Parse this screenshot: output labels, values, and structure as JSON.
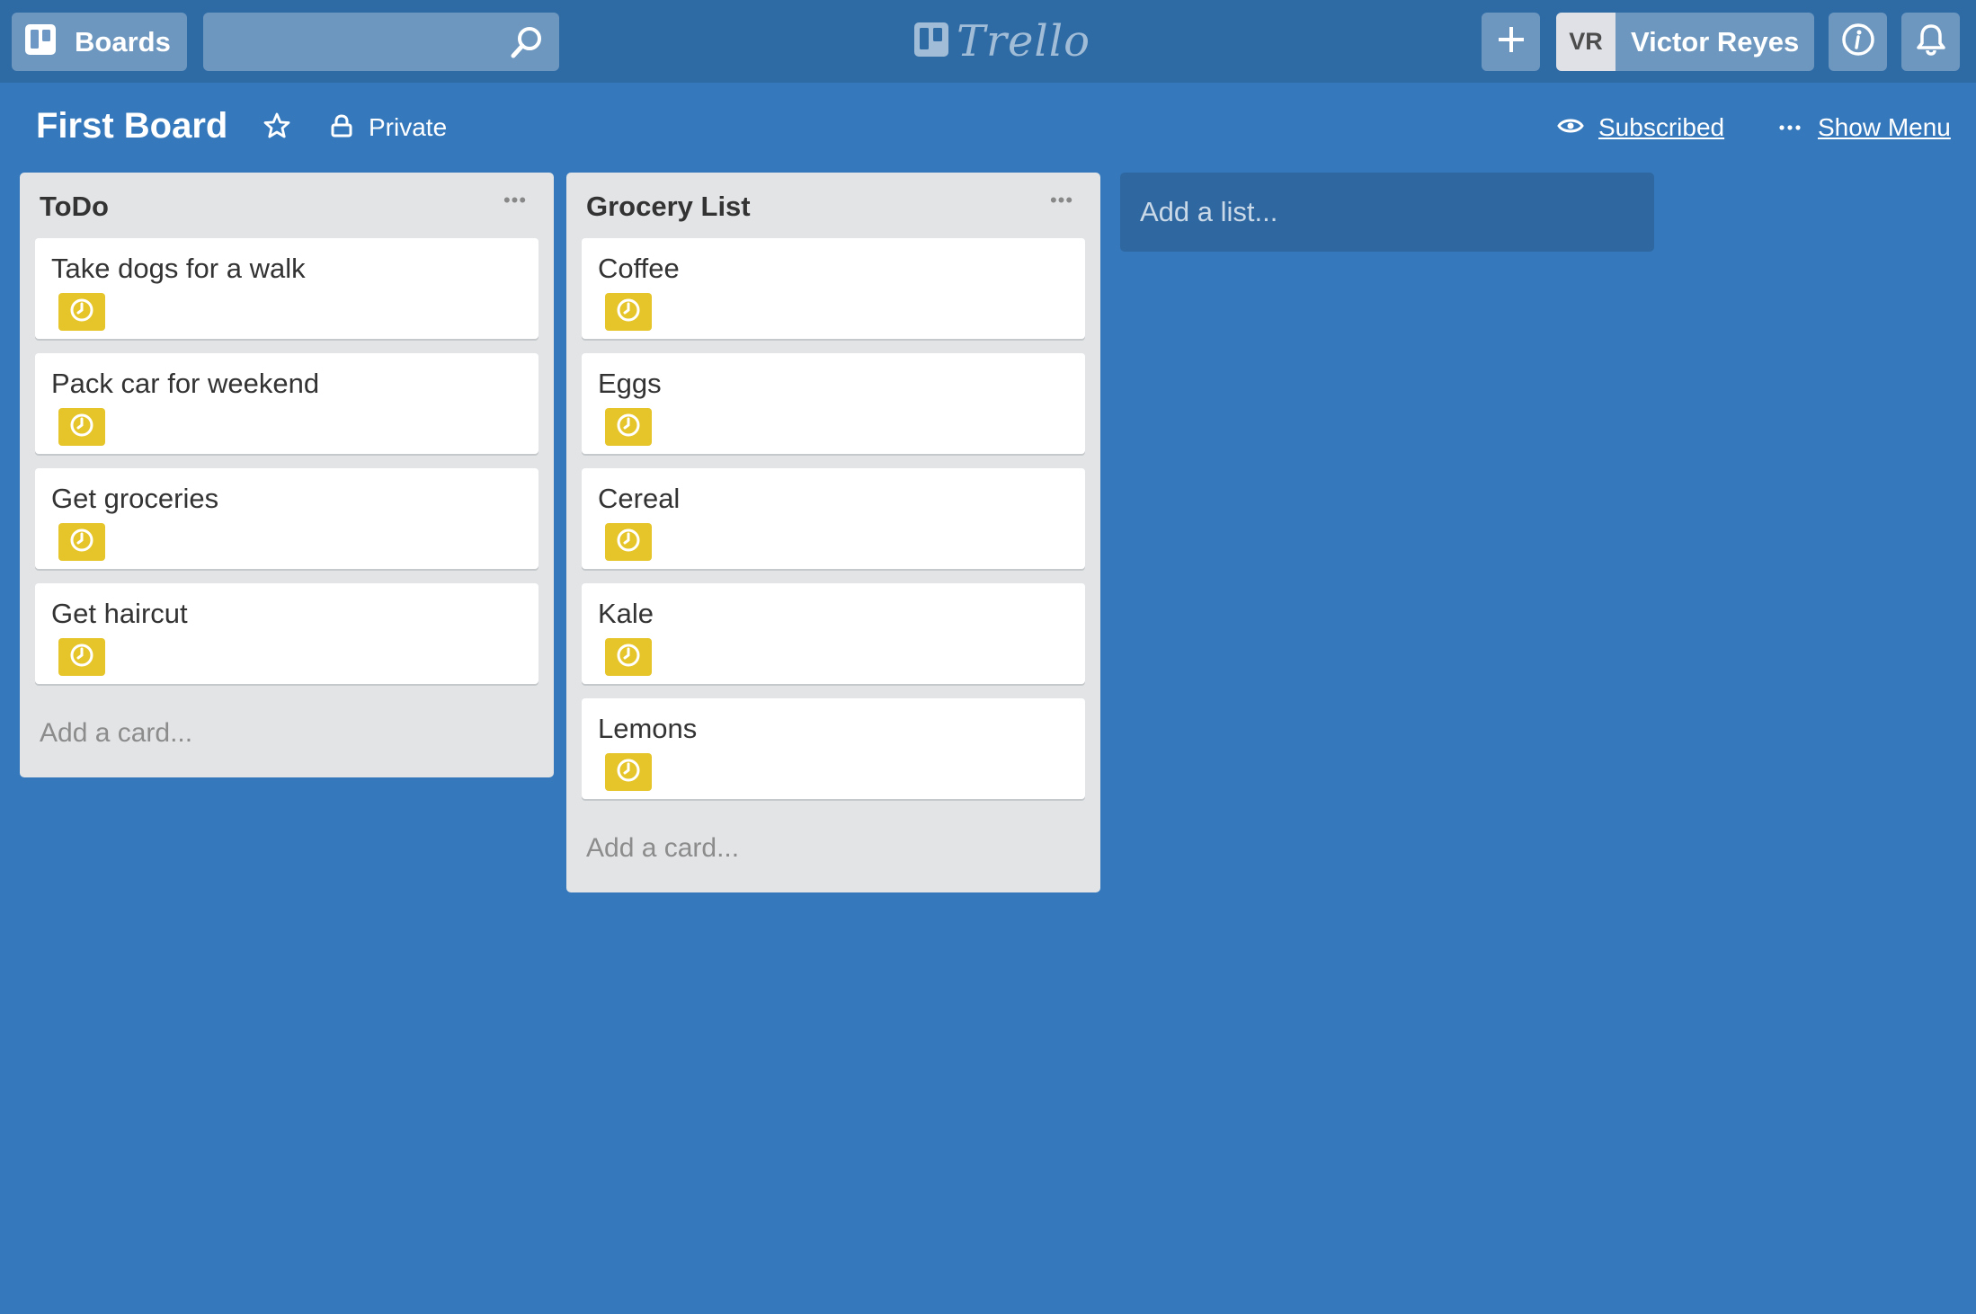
{
  "header": {
    "boards_label": "Boards",
    "search_value": "",
    "logo_text": "Trello",
    "user_initials": "VR",
    "user_name": "Victor Reyes"
  },
  "board": {
    "title": "First Board",
    "privacy_label": "Private",
    "subscribed_label": "Subscribed",
    "show_menu_label": "Show Menu"
  },
  "lists": [
    {
      "title": "ToDo",
      "cards": [
        {
          "title": "Take dogs for a walk"
        },
        {
          "title": "Pack car for weekend"
        },
        {
          "title": "Get groceries"
        },
        {
          "title": "Get haircut"
        }
      ],
      "add_card_label": "Add a card..."
    },
    {
      "title": "Grocery List",
      "cards": [
        {
          "title": "Coffee"
        },
        {
          "title": "Eggs"
        },
        {
          "title": "Cereal"
        },
        {
          "title": "Kale"
        },
        {
          "title": "Lemons"
        }
      ],
      "add_card_label": "Add a card..."
    }
  ],
  "add_list_label": "Add a list...",
  "colors": {
    "board_background": "#3578bb",
    "header_background": "#2e6aa4",
    "due_badge": "#e6c52a",
    "list_background": "#e2e4e6"
  },
  "icons": [
    "boards-icon",
    "search-icon",
    "trello-logo-icon",
    "plus-icon",
    "info-icon",
    "bell-icon",
    "star-icon",
    "lock-icon",
    "eye-icon",
    "more-icon",
    "clock-icon"
  ]
}
